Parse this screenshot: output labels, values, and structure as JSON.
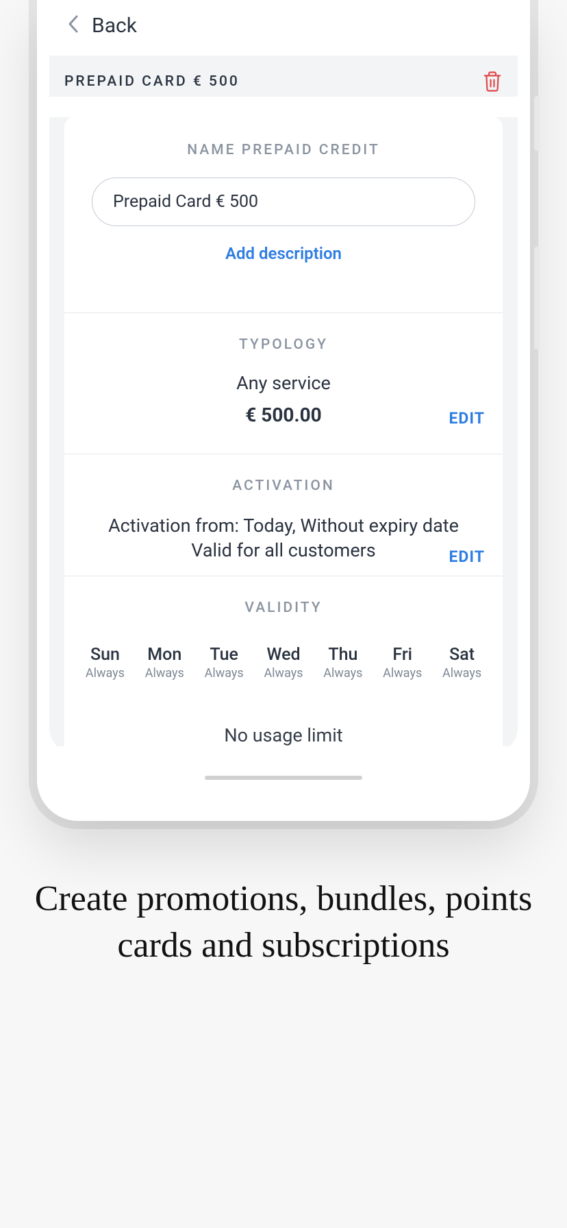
{
  "header": {
    "back_label": "Back"
  },
  "page_title": "PREPAID CARD € 500",
  "name_section": {
    "title": "NAME PREPAID CREDIT",
    "input_value": "Prepaid Card € 500",
    "add_description": "Add description"
  },
  "typology": {
    "title": "TYPOLOGY",
    "service": "Any service",
    "amount": "€ 500.00",
    "edit": "EDIT"
  },
  "activation": {
    "title": "ACTIVATION",
    "line1": "Activation from: Today, Without expiry date",
    "line2": "Valid for all customers",
    "edit": "EDIT"
  },
  "validity": {
    "title": "VALIDITY",
    "days": [
      {
        "name": "Sun",
        "sub": "Always"
      },
      {
        "name": "Mon",
        "sub": "Always"
      },
      {
        "name": "Tue",
        "sub": "Always"
      },
      {
        "name": "Wed",
        "sub": "Always"
      },
      {
        "name": "Thu",
        "sub": "Always"
      },
      {
        "name": "Fri",
        "sub": "Always"
      },
      {
        "name": "Sat",
        "sub": "Always"
      }
    ],
    "usage_limit": "No usage limit"
  },
  "caption": "Create promotions, bundles, points cards and subscriptions"
}
